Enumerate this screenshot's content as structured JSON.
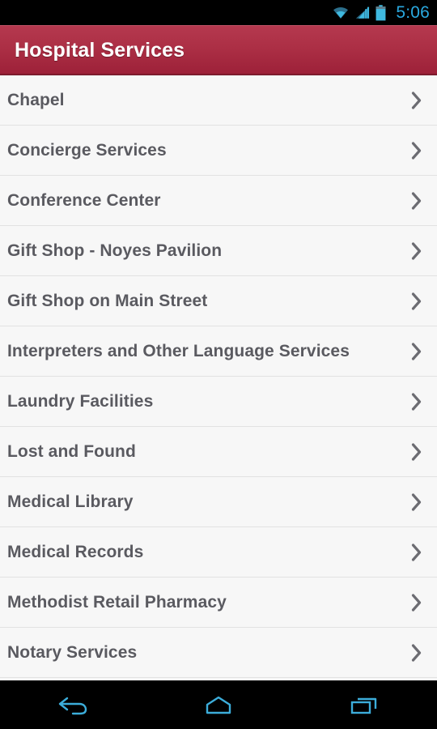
{
  "status_bar": {
    "time": "5:06",
    "icons": [
      "wifi-icon",
      "cellular-signal-icon",
      "battery-icon"
    ],
    "accent_color": "#2aa9e0",
    "background_color": "#000000"
  },
  "header": {
    "title": "Hospital Services",
    "background_top_color": "#b5394f",
    "background_bottom_color": "#9c2038",
    "text_color": "#ffffff"
  },
  "list": {
    "row_text_color": "#5a5a60",
    "row_background_color": "#f7f7f7",
    "divider_color": "#e2e2e2",
    "chevron_icon": "chevron-right-icon",
    "items": [
      {
        "label": "Chapel"
      },
      {
        "label": "Concierge Services"
      },
      {
        "label": "Conference Center"
      },
      {
        "label": "Gift Shop - Noyes Pavilion"
      },
      {
        "label": "Gift Shop on Main Street"
      },
      {
        "label": "Interpreters and Other Language Services"
      },
      {
        "label": "Laundry Facilities"
      },
      {
        "label": "Lost and Found"
      },
      {
        "label": "Medical Library"
      },
      {
        "label": "Medical Records"
      },
      {
        "label": "Methodist Retail Pharmacy"
      },
      {
        "label": "Notary Services"
      }
    ]
  },
  "nav_bar": {
    "accent_color": "#3cadda",
    "background_color": "#000000",
    "buttons": [
      {
        "name": "back-icon",
        "label": "Back"
      },
      {
        "name": "home-icon",
        "label": "Home"
      },
      {
        "name": "recent-apps-icon",
        "label": "Recent apps"
      }
    ]
  }
}
